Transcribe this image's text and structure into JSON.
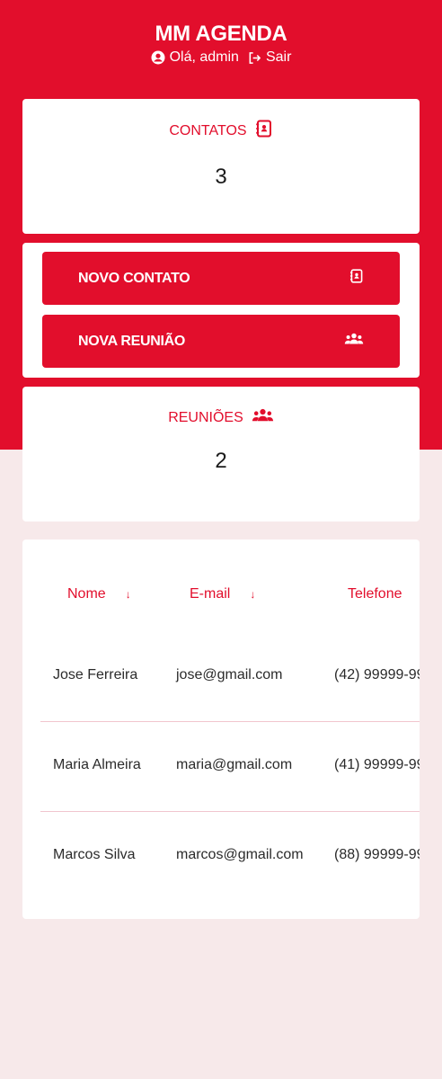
{
  "header": {
    "title": "MM AGENDA",
    "greeting": "Olá, admin",
    "logout_label": "Sair"
  },
  "stats": {
    "contacts": {
      "label": "CONTATOS",
      "value": "3",
      "icon": "address-book-icon"
    },
    "meetings": {
      "label": "REUNIÕES",
      "value": "2",
      "icon": "users-icon"
    }
  },
  "actions": {
    "new_contact": {
      "label": "NOVO CONTATO",
      "icon": "address-book-icon"
    },
    "new_meeting": {
      "label": "NOVA REUNIÃO",
      "icon": "users-icon"
    }
  },
  "table": {
    "columns": [
      {
        "label": "Nome",
        "sortable": true
      },
      {
        "label": "E-mail",
        "sortable": true
      },
      {
        "label": "Telefone",
        "sortable": false
      }
    ],
    "rows": [
      {
        "nome": "Jose Ferreira",
        "email": "jose@gmail.com",
        "telefone": "(42) 99999-99"
      },
      {
        "nome": "Maria Almeira",
        "email": "maria@gmail.com",
        "telefone": "(41) 99999-99"
      },
      {
        "nome": "Marcos Silva",
        "email": "marcos@gmail.com",
        "telefone": "(88) 99999-99"
      }
    ]
  },
  "colors": {
    "brand": "#e20e2c",
    "background": "#f7e9ea",
    "surface": "#ffffff"
  }
}
